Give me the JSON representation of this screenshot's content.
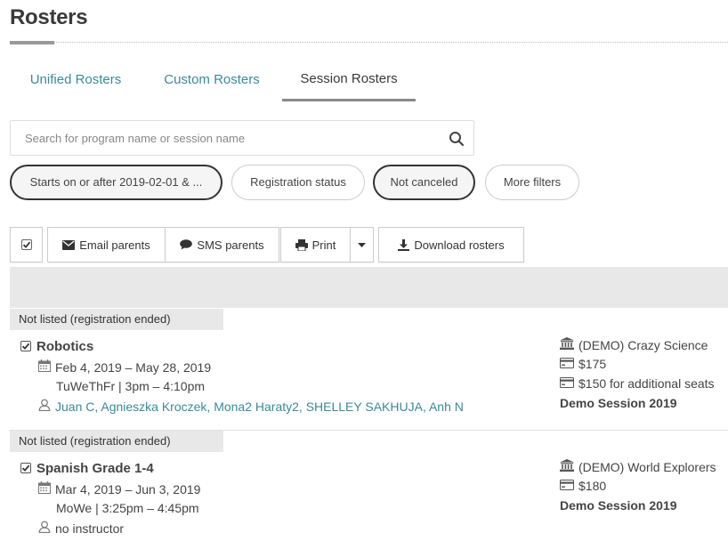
{
  "page": {
    "title": "Rosters"
  },
  "tabs": [
    {
      "label": "Unified Rosters",
      "active": false
    },
    {
      "label": "Custom Rosters",
      "active": false
    },
    {
      "label": "Session Rosters",
      "active": true
    }
  ],
  "search": {
    "placeholder": "Search for program name or session name",
    "value": ""
  },
  "filters": [
    {
      "label": "Starts on or after 2019-02-01 & ...",
      "selected": true
    },
    {
      "label": "Registration status",
      "selected": false
    },
    {
      "label": "Not canceled",
      "selected": true
    },
    {
      "label": "More filters",
      "selected": false
    }
  ],
  "toolbar": {
    "select_all_checked": true,
    "email_label": "Email parents",
    "sms_label": "SMS parents",
    "print_label": "Print",
    "download_label": "Download rosters"
  },
  "groups": [
    {
      "label": "Not listed (registration ended)",
      "program": {
        "checked": true,
        "name": "Robotics",
        "dates": "Feb 4, 2019 – May 28, 2019",
        "schedule": "TuWeThFr | 3pm – 4:10pm",
        "instructors": "Juan C, Agnieszka Kroczek, Mona2 Haraty2, SHELLEY SAKHUJA, Anh N",
        "instructors_linked": true,
        "provider": "(DEMO) Crazy Science",
        "price": "$175",
        "additional": "$150 for additional seats",
        "session": "Demo Session 2019"
      }
    },
    {
      "label": "Not listed (registration ended)",
      "program": {
        "checked": true,
        "name": "Spanish Grade 1-4",
        "dates": "Mar 4, 2019 – Jun 3, 2019",
        "schedule": "MoWe | 3:25pm – 4:45pm",
        "instructors": "no instructor",
        "instructors_linked": false,
        "provider": "(DEMO) World Explorers",
        "price": "$180",
        "additional": "",
        "session": "Demo Session 2019"
      }
    }
  ],
  "colors": {
    "link": "#3a8a99",
    "band": "#e8e8e8",
    "text": "#444444"
  }
}
